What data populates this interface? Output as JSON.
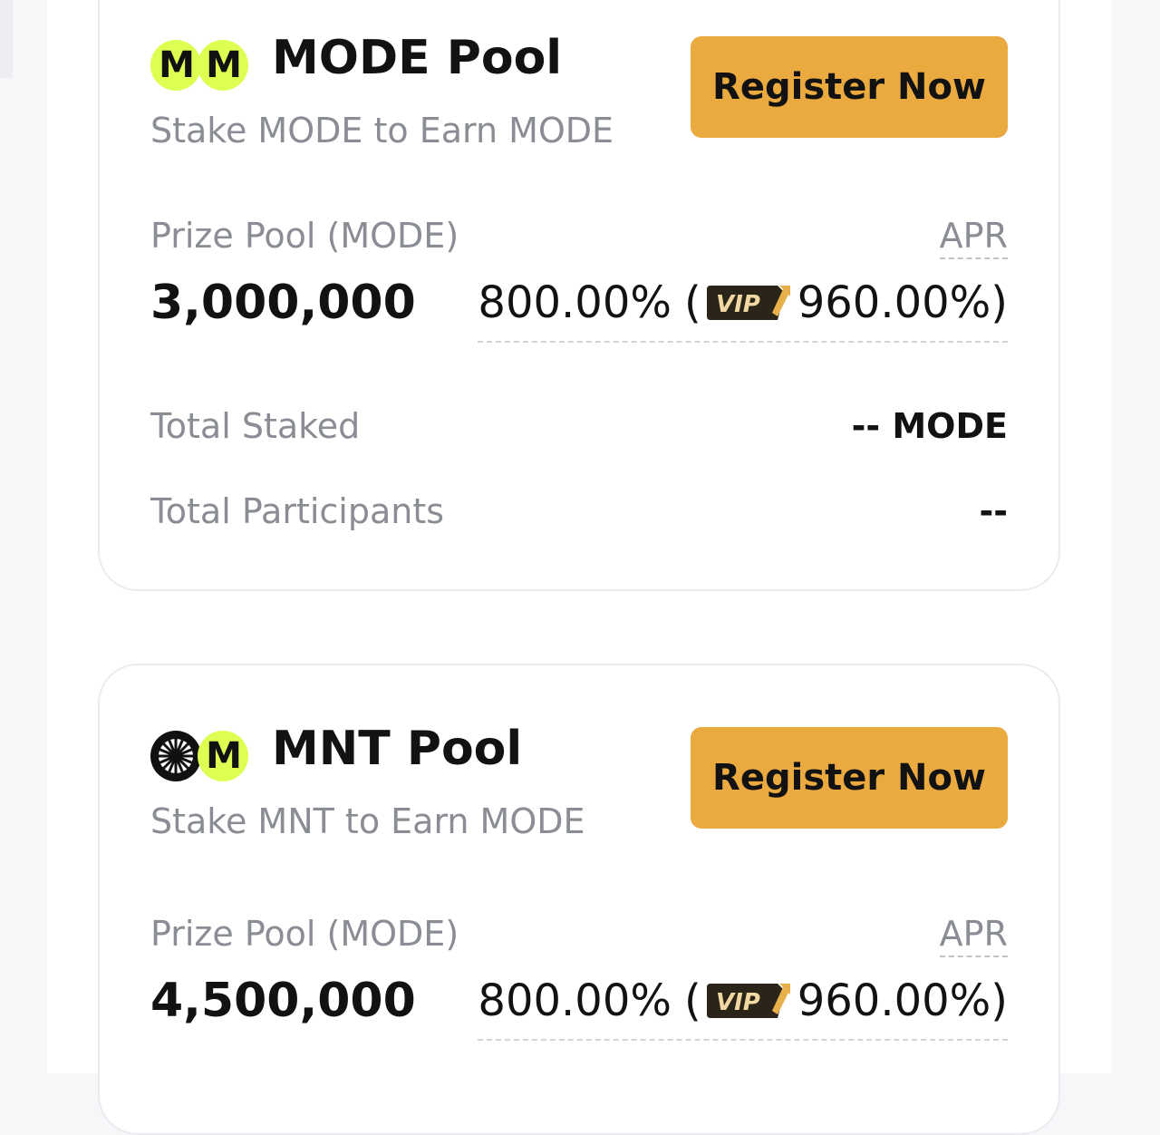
{
  "pools": [
    {
      "title": "MODE Pool",
      "subtitle": "Stake MODE to Earn MODE",
      "register_label": "Register Now",
      "coin_a_label": "M",
      "coin_b_label": "M",
      "prize_label": "Prize Pool (MODE)",
      "prize_value": "3,000,000",
      "apr_label": "APR",
      "apr_base": "800.00%",
      "apr_open": "(",
      "vip_label": "VIP",
      "apr_vip": "960.00%)",
      "total_staked_label": "Total Staked",
      "total_staked_value": "-- MODE",
      "total_participants_label": "Total Participants",
      "total_participants_value": "--"
    },
    {
      "title": "MNT Pool",
      "subtitle": "Stake MNT to Earn MODE",
      "register_label": "Register Now",
      "coin_b_label": "M",
      "prize_label": "Prize Pool (MODE)",
      "prize_value": "4,500,000",
      "apr_label": "APR",
      "apr_base": "800.00%",
      "apr_open": "(",
      "vip_label": "VIP",
      "apr_vip": "960.00%)"
    }
  ],
  "colors": {
    "accent_button": "#eaaa3f",
    "mode_coin": "#dcff52",
    "mnt_coin": "#111111",
    "muted_text": "#8a8d93",
    "vip_badge": "#2b2418",
    "vip_gold": "#e8b04a"
  },
  "icons": {
    "mode_coin": "mode-coin-icon",
    "mnt_coin": "mnt-coin-icon",
    "vip_badge": "vip-badge-icon"
  }
}
